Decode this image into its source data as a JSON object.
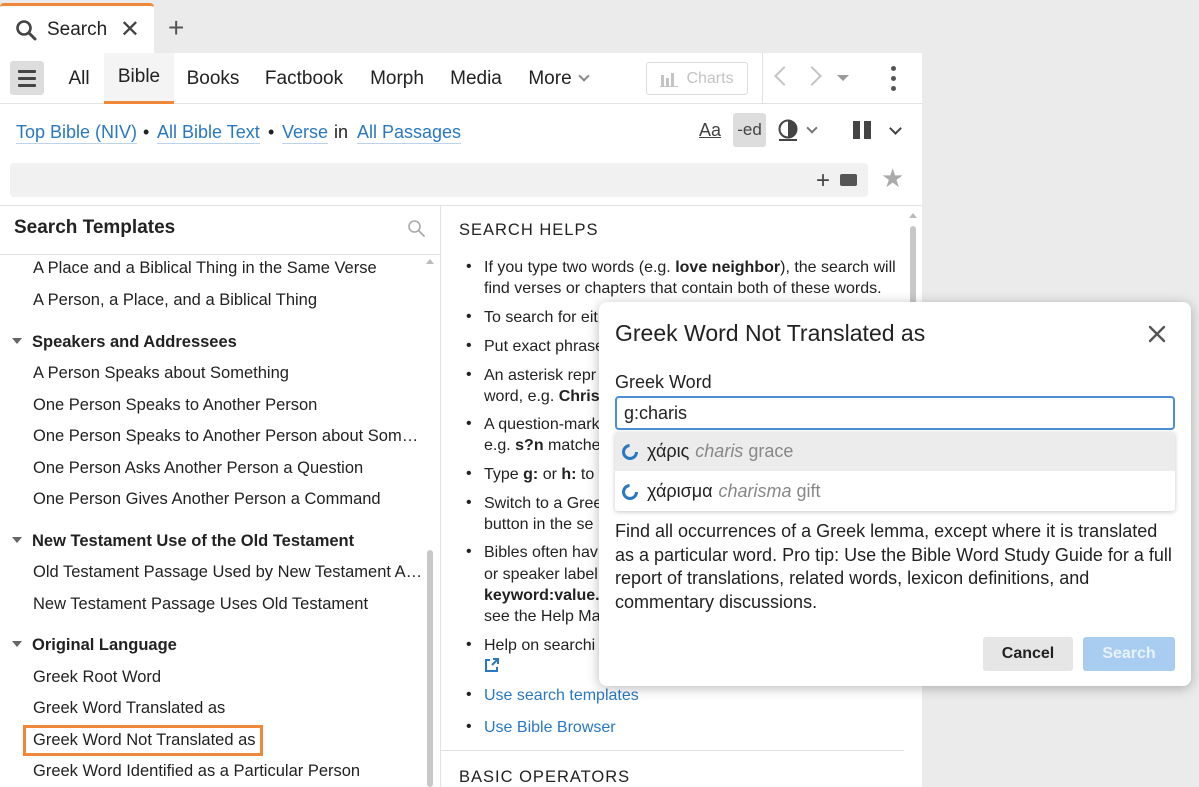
{
  "tabs": {
    "active_label": "Search",
    "close_glyph": "✕",
    "add_glyph": "+"
  },
  "nav": {
    "items": [
      "All",
      "Bible",
      "Books",
      "Factbook",
      "Morph",
      "Media",
      "More"
    ],
    "active": "Bible",
    "charts_label": "Charts"
  },
  "scope": {
    "top_bible": "Top Bible (NIV)",
    "all_text": "All Bible Text",
    "unit": "Verse",
    "in": "in",
    "passages": "All Passages",
    "sep": "•"
  },
  "toolbar": {
    "aa": "Aa",
    "ed": "-ed"
  },
  "search": {
    "value": "",
    "placeholder": ""
  },
  "templates": {
    "header": "Search Templates",
    "items": [
      "A Place and a Biblical Thing in the Same Verse",
      "A Person, a Place, and a Biblical Thing",
      "Speakers and Addressees",
      "A Person Speaks about Something",
      "One Person Speaks to Another Person",
      "One Person Speaks to Another Person about Som…",
      "One Person Asks Another Person a Question",
      "One Person Gives Another Person a Command",
      "New Testament Use of the Old Testament",
      "Old Testament Passage Used by New Testament A…",
      "New Testament Passage Uses Old Testament",
      "Original Language",
      "Greek Root Word",
      "Greek Word Translated as",
      "Greek Word Not Translated as",
      "Greek Word Identified as a Particular Person"
    ]
  },
  "helps": {
    "header": "SEARCH HELPS",
    "l1a": "If you type two words (e.g. ",
    "l1b": "love neighbor",
    "l1c": "), the search will",
    "l2": "find verses or chapters that contain both of these words.",
    "l3": "To search for eit",
    "l4": "Put exact phrase",
    "l5": "An asterisk repr",
    "l6a": "word, e.g. ",
    "l6b": "Christ",
    "l7": "A question-mark",
    "l8a": "e.g. ",
    "l8b": "s?n",
    "l8c": " matches",
    "l9a": "Type ",
    "l9b": "g:",
    "l9c": " or ",
    "l9d": "h:",
    "l9e": " to t",
    "l10": "Switch to a Gree",
    "l11": "button in the se",
    "l12": "Bibles often hav",
    "l13": "or speaker label",
    "l14a": "keyword:value.",
    "l15": "see the Help Ma",
    "l16": "Help on searchi",
    "link1": "Use search templates",
    "link2": "Use Bible Browser",
    "basic": "BASIC OPERATORS"
  },
  "dialog": {
    "title": "Greek Word Not Translated as",
    "field_label": "Greek Word",
    "input_value": "g:charis",
    "suggestions": [
      {
        "greek": "χάρις",
        "translit": "charis",
        "gloss": "grace"
      },
      {
        "greek": "χάρισμα",
        "translit": "charisma",
        "gloss": "gift"
      }
    ],
    "description": "Find all occurrences of a Greek lemma, except where it is translated as a particular word. Pro tip: Use the Bible Word Study Guide for a full report of translations, related words, lexicon definitions, and commentary discussions.",
    "cancel": "Cancel",
    "search": "Search"
  },
  "colors": {
    "accent": "#f0883a",
    "link": "#2a78c2",
    "search_btn": "#a9cdf0"
  }
}
